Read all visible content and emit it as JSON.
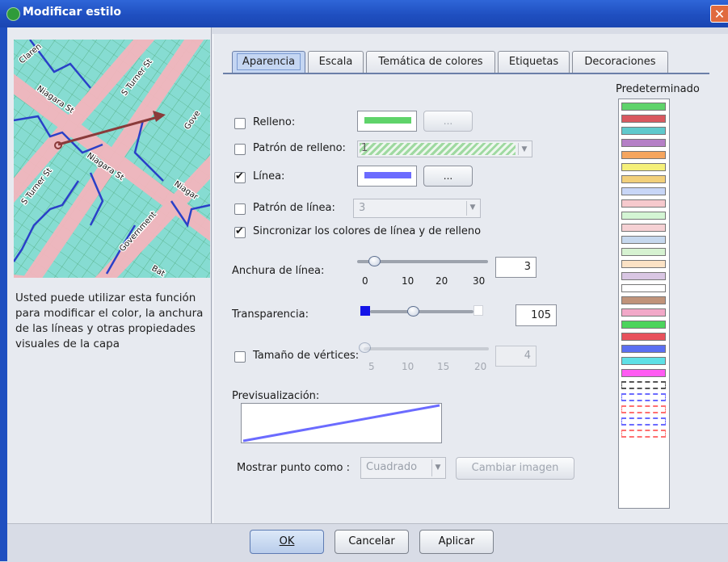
{
  "window": {
    "title": "Modificar estilo",
    "close_symbol": "✕"
  },
  "left": {
    "map_labels": [
      "Claren",
      "S Turner St",
      "Niagara St",
      "Niagara St",
      "S Turner St",
      "Niagar",
      "Government",
      "Bat",
      "Gove"
    ],
    "description": "Usted puede utilizar esta función para modificar el color, la anchura de las líneas y otras propiedades visuales de la capa"
  },
  "tabs": [
    "Aparencia",
    "Escala",
    "Temática de colores",
    "Etiquetas",
    "Decoraciones"
  ],
  "active_tab": "Aparencia",
  "appearance": {
    "fill": {
      "label": "Relleno:",
      "checked": false,
      "color": "#5fd36a",
      "button": "..."
    },
    "fill_pattern": {
      "label": "Patrón de relleno:",
      "checked": false,
      "value": "1"
    },
    "line": {
      "label": "Línea:",
      "checked": true,
      "color": "#6b6bff",
      "button": "..."
    },
    "line_pattern": {
      "label": "Patrón de línea:",
      "checked": false,
      "value": "3"
    },
    "sync": {
      "label": "Sincronizar los colores de línea y de relleno",
      "checked": true
    },
    "line_width": {
      "label": "Anchura de línea:",
      "value": "3",
      "ticks": [
        "0",
        "10",
        "20",
        "30"
      ]
    },
    "transparency": {
      "label": "Transparencia:",
      "value": "105",
      "level": 105,
      "max": 255
    },
    "vertex_size": {
      "label": "Tamaño de vértices:",
      "checked": false,
      "value": "4",
      "ticks": [
        "5",
        "10",
        "15",
        "20"
      ]
    },
    "preview_label": "Previsualización:",
    "show_point": {
      "label": "Mostrar punto como :",
      "value": "Cuadrado",
      "button": "Cambiar imagen"
    }
  },
  "palette": {
    "title": "Predeterminado",
    "swatches": [
      "#5fd36a",
      "#d9585f",
      "#5fc9cc",
      "#b580c6",
      "#f5a55e",
      "#f5f07a",
      "#f2d07b",
      "#c8d6f7",
      "#f6c9cd",
      "#d4f5d4",
      "#f6d1d4",
      "#c6d8ee",
      "#d6f2d1",
      "#fbe2c5",
      "#d9c6e3",
      "#ffffff",
      "#c0937a",
      "#f2a8c8",
      "#4cd45c",
      "#e8525c",
      "#5b6ff2",
      "#5ee0e6",
      "#ff5bf2",
      "#ffffff",
      "#6b6bff",
      "#ff7070",
      "#6b6bff",
      "#ff7070"
    ]
  },
  "footer": {
    "ok": "OK",
    "cancel": "Cancelar",
    "apply": "Aplicar"
  }
}
